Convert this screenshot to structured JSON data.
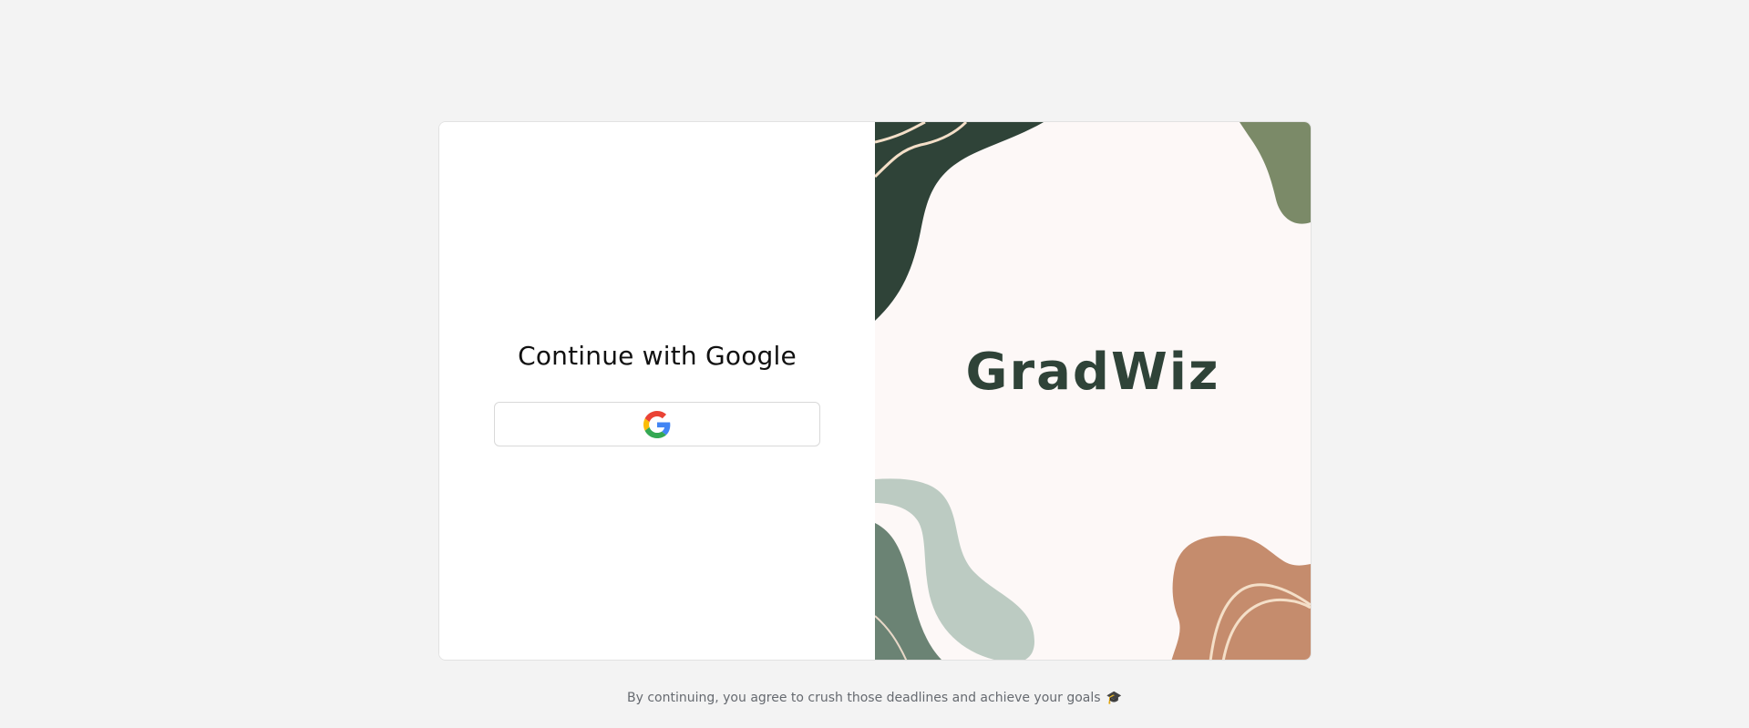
{
  "login": {
    "heading": "Continue with Google",
    "google_button_icon": "google-g-icon"
  },
  "brand": {
    "name": "GradWiz",
    "color": "#2f4338"
  },
  "palette": {
    "dark_green": "#2f4338",
    "sage": "#7b8a68",
    "mint": "#bccbc2",
    "moss": "#6b8374",
    "terracotta": "#c58c6d",
    "cream_line": "#f4dfc8",
    "background": "#fdf8f7"
  },
  "footer": {
    "text": "By continuing, you agree to crush those deadlines and achieve your goals",
    "icon": "🎓"
  }
}
